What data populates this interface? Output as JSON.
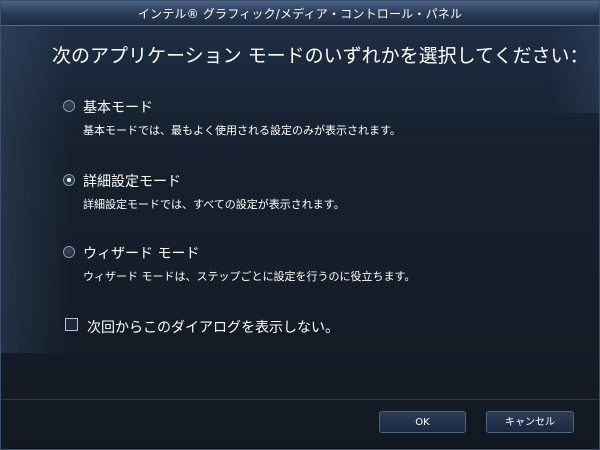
{
  "window": {
    "title": "インテル® グラフィック/メディア・コントロール・パネル"
  },
  "heading": "次のアプリケーション モードのいずれかを選択してください：",
  "options": [
    {
      "label": "基本モード",
      "description": "基本モードでは、最もよく使用される設定のみが表示されます。",
      "selected": false
    },
    {
      "label": "詳細設定モード",
      "description": "詳細設定モードでは、すべての設定が表示されます。",
      "selected": true
    },
    {
      "label": "ウィザード モード",
      "description": "ウィザード モードは、ステップごとに設定を行うのに役立ちます。",
      "selected": false
    }
  ],
  "dont_show": {
    "label": "次回からこのダイアログを表示しない。",
    "checked": false
  },
  "buttons": {
    "ok": "OK",
    "cancel": "キャンセル"
  }
}
